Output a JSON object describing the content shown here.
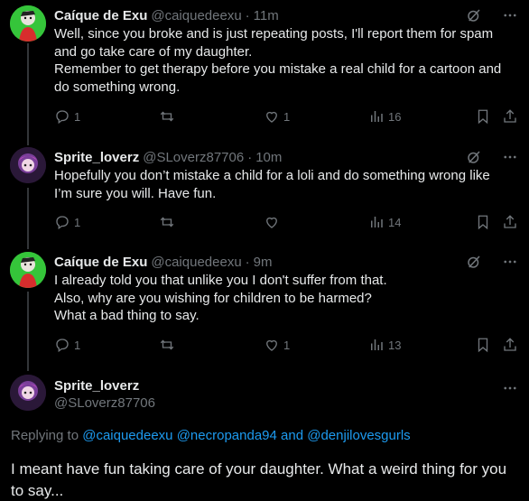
{
  "replies": [
    {
      "name": "Caíque de Exu",
      "handle": "@caiquedeexu",
      "separator": "·",
      "time": "11m",
      "lines": [
        "Well, since you broke and is just repeating posts, I'll report them for spam",
        "and go take care of my daughter.",
        "Remember to get therapy before you mistake a real child for a cartoon and",
        "do something wrong."
      ],
      "replies_count": "1",
      "reposts_count": "",
      "likes_count": "1",
      "views_count": "16"
    },
    {
      "name": "Sprite_loverz",
      "handle": "@SLoverz87706",
      "separator": "·",
      "time": "10m",
      "lines": [
        "Hopefully you don’t mistake a child for a loli and do something wrong like",
        "I’m sure you will. Have fun."
      ],
      "replies_count": "1",
      "reposts_count": "",
      "likes_count": "",
      "views_count": "14"
    },
    {
      "name": "Caíque de Exu",
      "handle": "@caiquedeexu",
      "separator": "·",
      "time": "9m",
      "lines": [
        "I already told you that unlike you I don't suffer from that.",
        "Also, why are you wishing for children to be harmed?",
        "What a bad thing to say."
      ],
      "replies_count": "1",
      "reposts_count": "",
      "likes_count": "1",
      "views_count": "13"
    }
  ],
  "main_post": {
    "name": "Sprite_loverz",
    "handle": "@SLoverz87706",
    "replying_prefix": "Replying to",
    "mention_1": "@caiquedeexu",
    "mention_2": "@necropanda94",
    "and_word": "and",
    "mention_3": "@denjilovesgurls",
    "lines": [
      "I meant have fun taking care of your daughter. What a weird thing for you",
      "to say..."
    ]
  },
  "colors": {
    "background": "#000000",
    "text": "#e7e9ea",
    "muted": "#71767b",
    "link": "#1d9bf0",
    "thread_line": "#333639"
  },
  "icons": [
    "grok-icon",
    "more-icon",
    "reply-icon",
    "repost-icon",
    "like-icon",
    "views-icon",
    "bookmark-icon",
    "share-icon"
  ]
}
